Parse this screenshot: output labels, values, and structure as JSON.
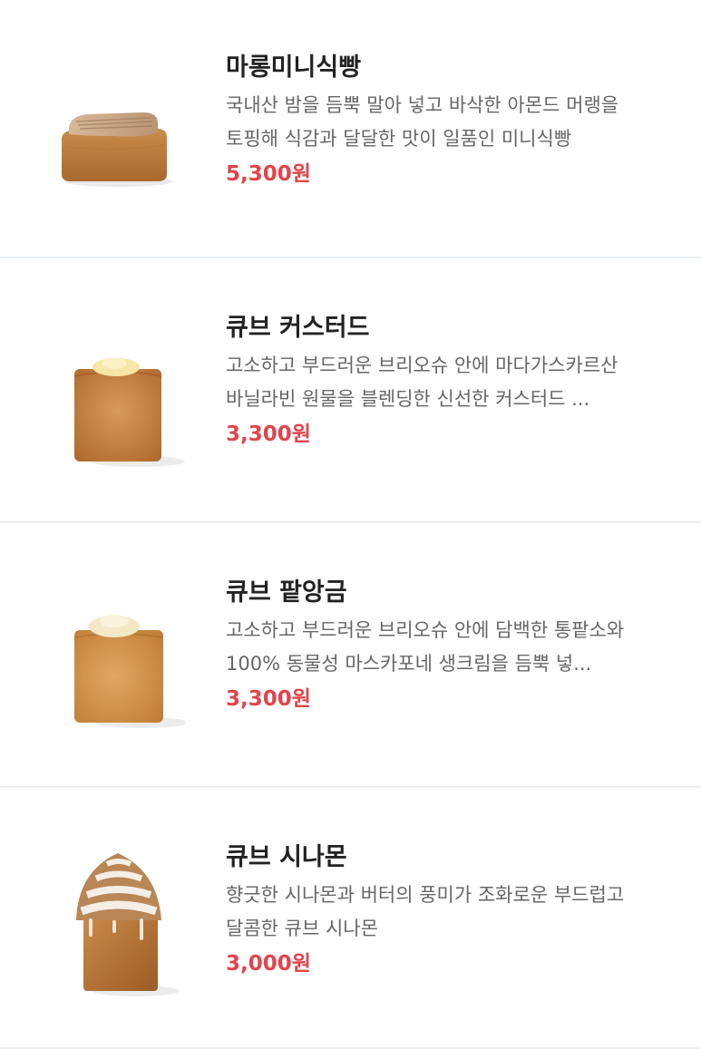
{
  "colors": {
    "price": "#e2444a",
    "name": "#222222",
    "description": "#666666",
    "divider": "#eceef2"
  },
  "menu_items": [
    {
      "name": "마롱미니식빵",
      "description": "국내산 밤을 듬뿍 말아 넣고 바삭한 아몬드 머랭을 토핑해 식감과 달달한 맛이 일품인 미니식빵",
      "price": "5,300원",
      "image_icon": "mini-bread-loaf-icon"
    },
    {
      "name": "큐브 커스터드",
      "description": "고소하고 부드러운 브리오슈 안에 마다가스카르산 바닐라빈 원물을 블렌딩한 신선한 커스터드 ...",
      "price": "3,300원",
      "image_icon": "cube-custard-bread-icon"
    },
    {
      "name": "큐브 팥앙금",
      "description": "고소하고 부드러운 브리오슈 안에 담백한 통팥소와 100% 동물성 마스카포네 생크림을 듬뿍 넣...",
      "price": "3,300원",
      "image_icon": "cube-red-bean-bread-icon"
    },
    {
      "name": "큐브 시나몬",
      "description": "향긋한 시나몬과 버터의 풍미가 조화로운 부드럽고 달콤한 큐브 시나몬",
      "price": "3,000원",
      "image_icon": "cube-cinnamon-bread-icon"
    }
  ]
}
